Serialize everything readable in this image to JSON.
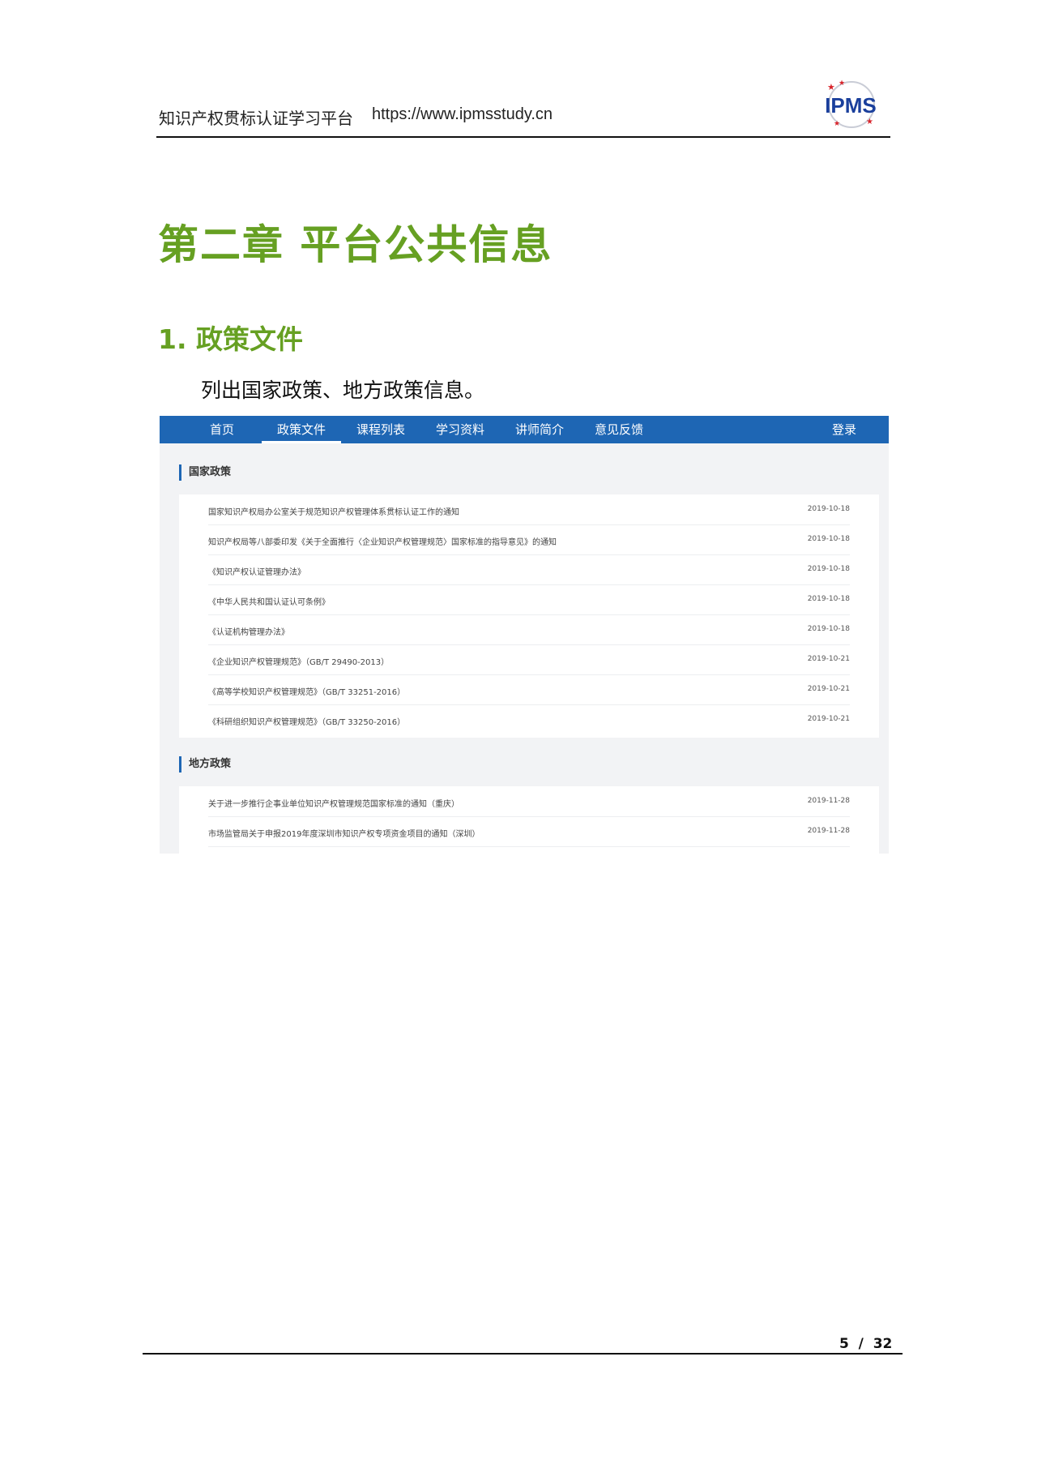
{
  "header": {
    "title": "知识产权贯标认证学习平台",
    "url": "https://www.ipmsstudy.cn",
    "logo_text": "IPMS"
  },
  "chapter_title": "第二章  平台公共信息",
  "section_title": "1. 政策文件",
  "intro_text": "列出国家政策、地方政策信息。",
  "screenshot": {
    "nav": {
      "items": [
        "首页",
        "政策文件",
        "课程列表",
        "学习资料",
        "讲师简介",
        "意见反馈"
      ],
      "active_index": 1,
      "login": "登录"
    },
    "national": {
      "heading": "国家政策",
      "rows": [
        {
          "title": "国家知识产权局办公室关于规范知识产权管理体系贯标认证工作的通知",
          "date": "2019-10-18"
        },
        {
          "title": "知识产权局等八部委印发《关于全面推行〈企业知识产权管理规范〉国家标准的指导意见》的通知",
          "date": "2019-10-18"
        },
        {
          "title": "《知识产权认证管理办法》",
          "date": "2019-10-18"
        },
        {
          "title": "《中华人民共和国认证认可条例》",
          "date": "2019-10-18"
        },
        {
          "title": "《认证机构管理办法》",
          "date": "2019-10-18"
        },
        {
          "title": "《企业知识产权管理规范》（GB/T 29490-2013）",
          "date": "2019-10-21"
        },
        {
          "title": "《高等学校知识产权管理规范》（GB/T 33251-2016）",
          "date": "2019-10-21"
        },
        {
          "title": "《科研组织知识产权管理规范》（GB/T 33250-2016）",
          "date": "2019-10-21"
        }
      ]
    },
    "local": {
      "heading": "地方政策",
      "rows": [
        {
          "title": "关于进一步推行企事业单位知识产权管理规范国家标准的通知（重庆）",
          "date": "2019-11-28"
        },
        {
          "title": "市场监管局关于申报2019年度深圳市知识产权专项资金项目的通知（深圳）",
          "date": "2019-11-28"
        }
      ]
    }
  },
  "footer": {
    "page_number": "5  /  32"
  },
  "colors": {
    "heading_green": "#66a022",
    "nav_blue": "#1e66b4",
    "logo_blue": "#1a3f9c",
    "logo_red": "#d8232a"
  }
}
